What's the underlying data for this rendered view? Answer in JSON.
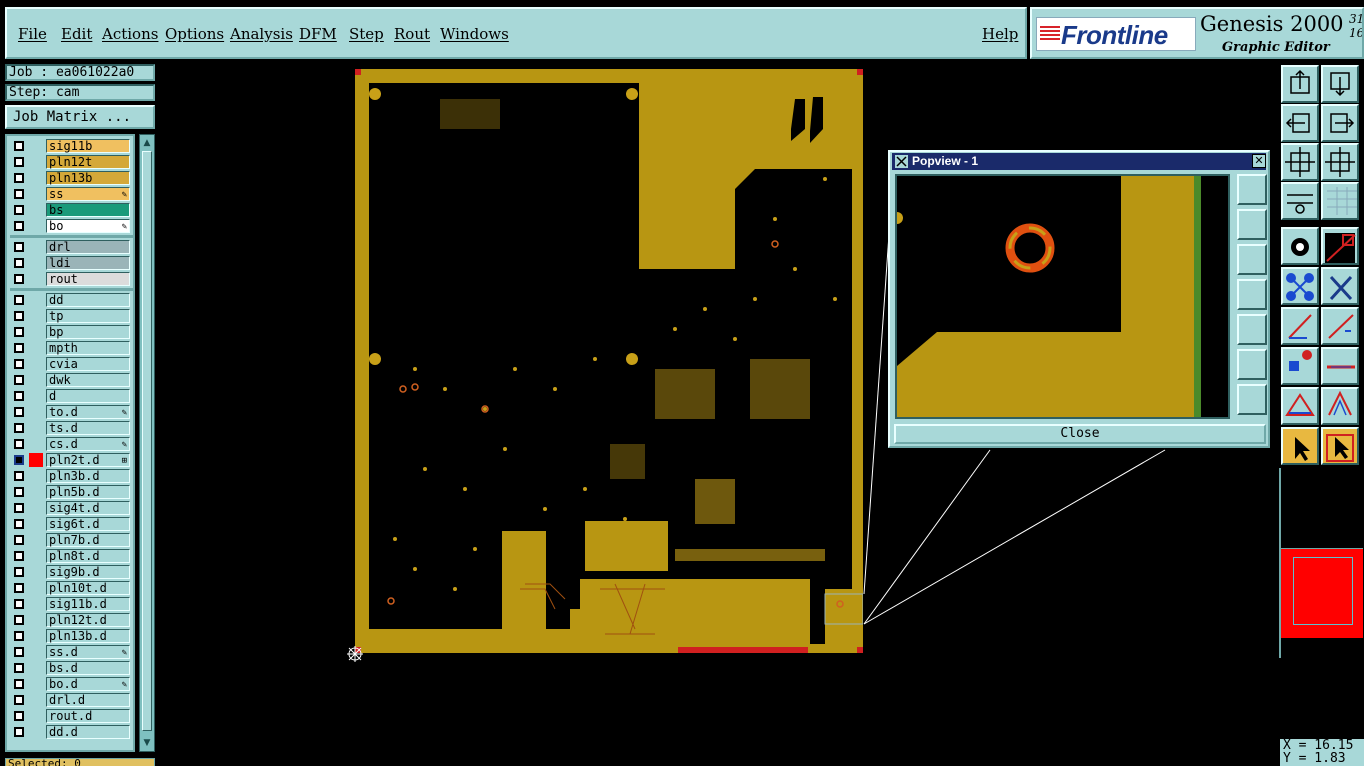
{
  "menubar": {
    "items": [
      "File",
      "Edit",
      "Actions",
      "Options",
      "Analysis",
      "DFM",
      "Step",
      "Rout",
      "Windows"
    ],
    "help": "Help"
  },
  "brand": {
    "logo": "Frontline",
    "title": "Genesis 2000",
    "sup": "31 16",
    "subtitle": "Graphic Editor"
  },
  "job": {
    "job_label": "Job : ea061022a0",
    "step_label": "Step: cam",
    "matrix_button": "Job Matrix ..."
  },
  "layers": [
    {
      "name": "sig11b",
      "color": "#f0c060"
    },
    {
      "name": "pln12t",
      "color": "#d4a838"
    },
    {
      "name": "pln13b",
      "color": "#d4a838"
    },
    {
      "name": "ss",
      "color": "#f0c060",
      "mark": "✎"
    },
    {
      "name": "bs",
      "color": "#1a9a7a"
    },
    {
      "name": "bo",
      "color": "#ffffff",
      "mark": "✎"
    },
    {
      "name": "drl",
      "color": "#9ab4b8"
    },
    {
      "name": "ldi",
      "color": "#9ab4b8"
    },
    {
      "name": "rout",
      "color": "#dcdcdc"
    },
    {
      "name": "dd"
    },
    {
      "name": "tp"
    },
    {
      "name": "bp"
    },
    {
      "name": "mpth"
    },
    {
      "name": "cvia"
    },
    {
      "name": "dwk"
    },
    {
      "name": "d"
    },
    {
      "name": "to.d",
      "mark": "✎"
    },
    {
      "name": "ts.d"
    },
    {
      "name": "cs.d",
      "mark": "✎"
    },
    {
      "name": "pln2t.d",
      "mark": "⊞",
      "active": true
    },
    {
      "name": "pln3b.d"
    },
    {
      "name": "pln5b.d"
    },
    {
      "name": "sig4t.d"
    },
    {
      "name": "sig6t.d"
    },
    {
      "name": "pln7b.d"
    },
    {
      "name": "pln8t.d"
    },
    {
      "name": "sig9b.d"
    },
    {
      "name": "pln10t.d"
    },
    {
      "name": "sig11b.d"
    },
    {
      "name": "pln12t.d"
    },
    {
      "name": "pln13b.d"
    },
    {
      "name": "ss.d",
      "mark": "✎"
    },
    {
      "name": "bs.d"
    },
    {
      "name": "bo.d",
      "mark": "✎"
    },
    {
      "name": "drl.d"
    },
    {
      "name": "rout.d"
    },
    {
      "name": "dd.d"
    }
  ],
  "selected_label": "Selected: 0",
  "popview": {
    "title": "Popview - 1",
    "close_label": "Close"
  },
  "coords": {
    "x": "X = 16.15",
    "y": "Y = 1.83"
  },
  "colors": {
    "copper": "#b89612",
    "panel": "#a8d8d8",
    "active_layer": "#ff0000",
    "titlebar": "#1a2a6a"
  }
}
